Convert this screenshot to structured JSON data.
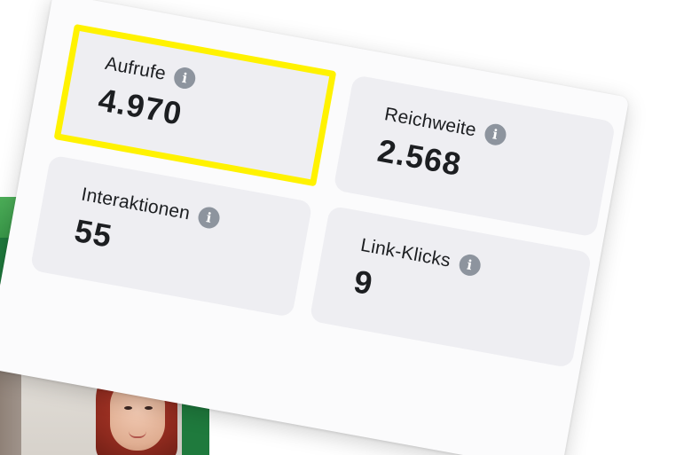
{
  "stats": {
    "views": {
      "label": "Aufrufe",
      "value": "4.970"
    },
    "reach": {
      "label": "Reichweite",
      "value": "2.568"
    },
    "interactions": {
      "label": "Interaktionen",
      "value": "55"
    },
    "link_clicks": {
      "label": "Link-Klicks",
      "value": "9"
    }
  },
  "highlight_color": "#fff200",
  "tile_color": "#eeeef2",
  "info_icon": {
    "name": "info-icon",
    "glyph": "i"
  }
}
